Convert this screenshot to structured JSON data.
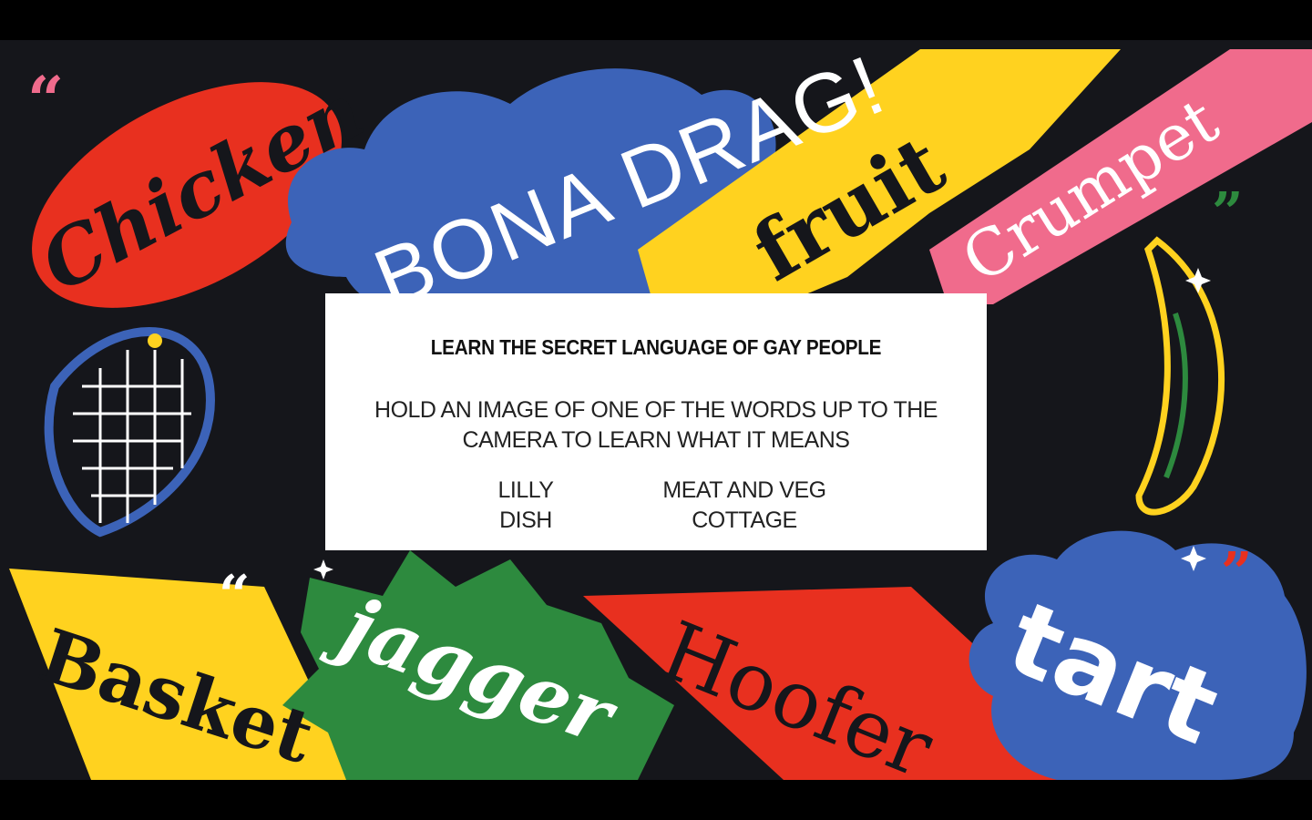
{
  "panel": {
    "title": "LEARN THE SECRET LANGUAGE OF GAY PEOPLE",
    "instruction": "HOLD AN IMAGE OF ONE OF THE WORDS UP TO THE CAMERA TO LEARN WHAT IT MEANS",
    "words_left": [
      "LILLY",
      "DISH"
    ],
    "words_right": [
      "MEAT AND VEG",
      "COTTAGE"
    ]
  },
  "artwork": {
    "words": [
      "Chicken",
      "BONA DRAG!",
      "fruit",
      "Crumpet",
      "Basket",
      "jagger",
      "Hoofer",
      "tart"
    ]
  },
  "colors": {
    "red": "#e8301f",
    "blue": "#3c63b8",
    "yellow": "#ffd21f",
    "pink": "#f06b8c",
    "green": "#2d8a3e",
    "dark": "#15161b"
  }
}
